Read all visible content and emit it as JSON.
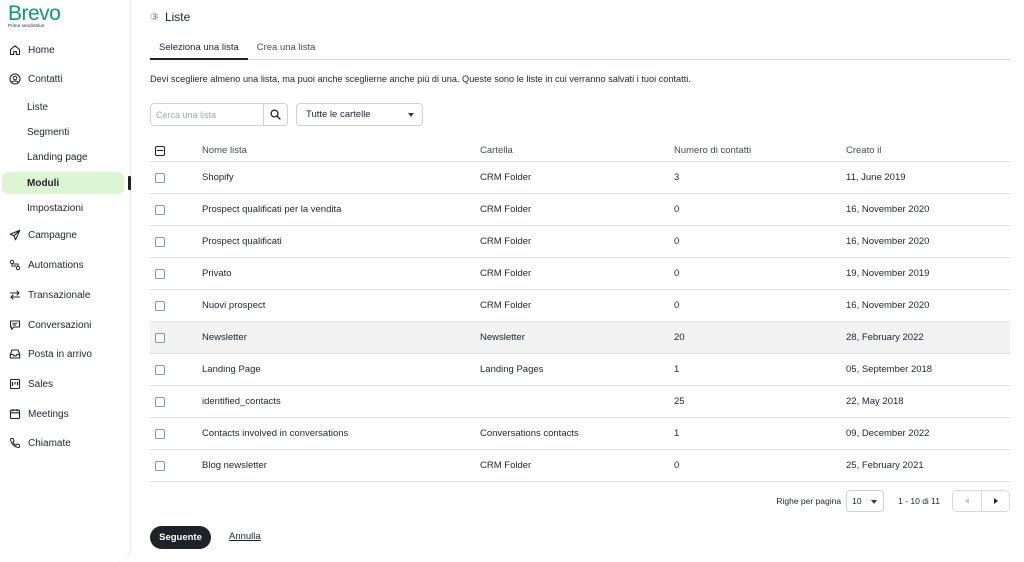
{
  "brand": {
    "name": "Brevo",
    "tagline": "Prima sendinblue",
    "color": "#0b996e"
  },
  "sidebar": {
    "items": [
      {
        "label": "Home",
        "icon": "home-icon"
      },
      {
        "label": "Contatti",
        "icon": "contacts-icon"
      },
      {
        "label": "Campagne",
        "icon": "send-icon"
      },
      {
        "label": "Automations",
        "icon": "automations-icon"
      },
      {
        "label": "Transazionale",
        "icon": "transfer-icon"
      },
      {
        "label": "Conversazioni",
        "icon": "chat-icon"
      },
      {
        "label": "Posta in arrivo",
        "icon": "inbox-icon"
      },
      {
        "label": "Sales",
        "icon": "sales-icon"
      },
      {
        "label": "Meetings",
        "icon": "calendar-icon"
      },
      {
        "label": "Chiamate",
        "icon": "phone-icon"
      }
    ],
    "contacts_sub": [
      "Liste",
      "Segmenti",
      "Landing page",
      "Moduli",
      "Impostazioni"
    ],
    "active_sub": "Moduli",
    "active_color": "#dcf5d3"
  },
  "page": {
    "step": "③",
    "title": "Liste",
    "tabs": [
      "Seleziona una lista",
      "Crea una lista"
    ],
    "description": "Devi scegliere almeno una lista, ma puoi anche sceglierne anche più di una. Queste sono le liste in cui verranno salvati i tuoi contatti."
  },
  "filters": {
    "search_placeholder": "Cerca una lista",
    "folder_select": "Tutte le cartelle"
  },
  "table": {
    "columns": [
      "Nome lista",
      "Cartella",
      "Numero di contatti",
      "Creato il"
    ],
    "rows": [
      {
        "name": "Shopify",
        "folder": "CRM Folder",
        "count": "3",
        "created": "11, June 2019"
      },
      {
        "name": "Prospect qualificati per la vendita",
        "folder": "CRM Folder",
        "count": "0",
        "created": "16, November 2020"
      },
      {
        "name": "Prospect qualificati",
        "folder": "CRM Folder",
        "count": "0",
        "created": "16, November 2020"
      },
      {
        "name": "Privato",
        "folder": "CRM Folder",
        "count": "0",
        "created": "19, November 2019"
      },
      {
        "name": "Nuovi prospect",
        "folder": "CRM Folder",
        "count": "0",
        "created": "16, November 2020"
      },
      {
        "name": "Newsletter",
        "folder": "Newsletter",
        "count": "20",
        "created": "28, February 2022"
      },
      {
        "name": "Landing Page",
        "folder": "Landing Pages",
        "count": "1",
        "created": "05, September 2018"
      },
      {
        "name": "identified_contacts",
        "folder": "",
        "count": "25",
        "created": "22, May 2018"
      },
      {
        "name": "Contacts involved in conversations",
        "folder": "Conversations contacts",
        "count": "1",
        "created": "09, December 2022"
      },
      {
        "name": "Blog newsletter",
        "folder": "CRM Folder",
        "count": "0",
        "created": "25, February 2021"
      }
    ]
  },
  "pagination": {
    "rows_label": "Righe per pagina",
    "rows_value": "10",
    "range": "1 - 10 di 11"
  },
  "actions": {
    "next": "Seguente",
    "cancel": "Annulla"
  }
}
